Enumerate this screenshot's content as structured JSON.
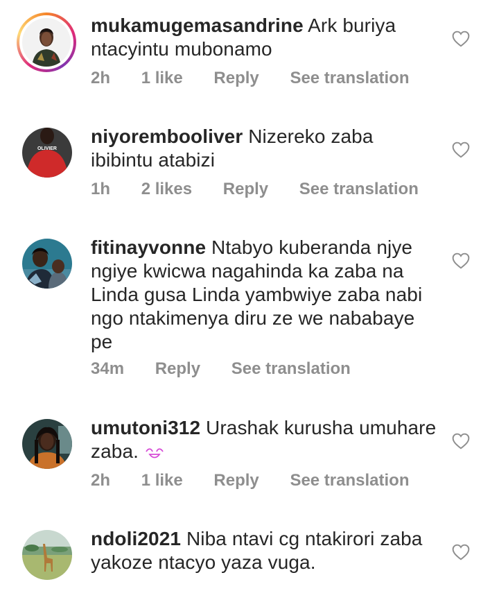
{
  "comments": [
    {
      "username": "mukamugemasandrine",
      "text": "Ark buriya ntacyintu mubonamo",
      "time": "2h",
      "likes": "1 like",
      "reply": "Reply",
      "translate": "See translation",
      "avatar_icon": "woman-portrait-avatar",
      "has_story_ring": true
    },
    {
      "username": "niyorembooliver",
      "text": "Nizereko zaba ibibintu atabizi",
      "time": "1h",
      "likes": "2 likes",
      "reply": "Reply",
      "translate": "See translation",
      "avatar_icon": "red-shirt-avatar",
      "avatar_text": "OLIVIER",
      "has_story_ring": false
    },
    {
      "username": "fitinayvonne",
      "text": "Ntabyo kuberanda njye ngiye kwicwa nagahinda ka zaba na Linda gusa Linda yambwiye zaba nabi ngo ntakimenya diru ze we nababaye pe",
      "time": "34m",
      "likes": "",
      "reply": "Reply",
      "translate": "See translation",
      "avatar_icon": "mother-child-avatar",
      "has_story_ring": false
    },
    {
      "username": "umutoni312",
      "text": "Urashak kurusha umuhare zaba.",
      "time": "2h",
      "likes": "1 like",
      "reply": "Reply",
      "translate": "See translation",
      "avatar_icon": "woman-braids-avatar",
      "emoji": "smiling-face-with-closed-eyes-emoji",
      "has_story_ring": false
    },
    {
      "username": "ndoli2021",
      "text": "Niba ntavi cg ntakirori zaba yakoze ntacyo yaza vuga.",
      "avatar_icon": "giraffe-landscape-avatar",
      "has_story_ring": false
    }
  ],
  "colors": {
    "text": "#262626",
    "meta": "#8e8e8e",
    "heart": "#8e8e8e",
    "story_ring": [
      "#f58529",
      "#dd2a7b",
      "#8134af",
      "#feda77"
    ]
  }
}
